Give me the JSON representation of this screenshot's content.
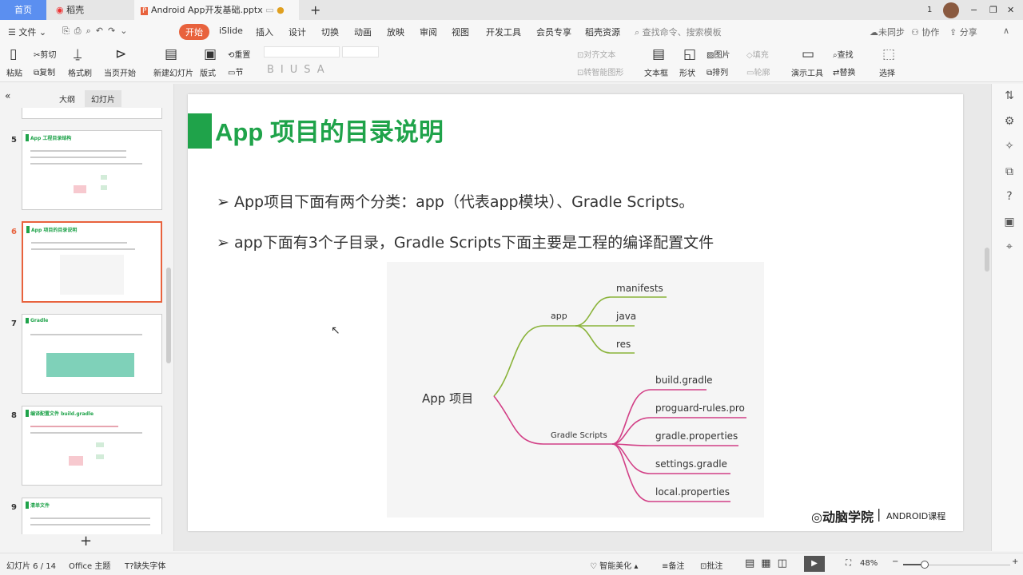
{
  "tabs": {
    "home": "首页",
    "daoke": "稻壳",
    "doc": "Android  App开发基础.pptx",
    "new": "+"
  },
  "window": {
    "count": "1",
    "min": "−",
    "restore": "❐",
    "close": "✕"
  },
  "menu": {
    "file": "文件",
    "items": [
      "开始",
      "iSlide",
      "插入",
      "设计",
      "切换",
      "动画",
      "放映",
      "审阅",
      "视图",
      "开发工具",
      "会员专享",
      "稻壳资源"
    ],
    "search": "查找命令、搜索模板",
    "sync": "未同步",
    "collab": "协作",
    "share": "分享"
  },
  "ribbon": {
    "paste": "粘贴",
    "cut": "剪切",
    "copy": "复制",
    "format_painter": "格式刷",
    "play_current": "当页开始",
    "new_slide": "新建幻灯片",
    "layout": "版式",
    "reset": "重置",
    "section": "节",
    "align_text": "对齐文本",
    "smart_art": "转智能图形",
    "textbox": "文本框",
    "shape": "形状",
    "picture": "图片",
    "fill": "填充",
    "arrange": "排列",
    "outline": "轮廓",
    "present_tools": "演示工具",
    "find": "查找",
    "replace": "替换",
    "select": "选择"
  },
  "panel": {
    "outline_tab": "大纲",
    "slides_tab": "幻灯片",
    "add": "+",
    "slides": [
      {
        "num": "5",
        "title": "App 工程目录结构"
      },
      {
        "num": "6",
        "title": "App 项目的目录说明"
      },
      {
        "num": "7",
        "title": "Gradle"
      },
      {
        "num": "8",
        "title": "编译配置文件 build.gradle"
      },
      {
        "num": "9",
        "title": "清单文件"
      }
    ]
  },
  "slide": {
    "title": "App 项目的目录说明",
    "bullets": [
      "App项目下面有两个分类：app（代表app模块）、Gradle Scripts。",
      "app下面有3个子目录，Gradle Scripts下面主要是工程的编译配置文件"
    ],
    "mindmap": {
      "root": "App 项目",
      "app": "app",
      "app_children": [
        "manifests",
        "java",
        "res"
      ],
      "gradle": "Gradle Scripts",
      "gradle_children": [
        "build.gradle",
        "proguard-rules.pro",
        "gradle.properties",
        "settings.gradle",
        "local.properties"
      ]
    },
    "logo": "动脑学院",
    "course": "ANDROID课程",
    "colors": {
      "green": "#1fa34a",
      "app_branch": "#8ab33a",
      "gradle_branch": "#d23f86"
    }
  },
  "status": {
    "slide_count": "幻灯片 6 / 14",
    "theme": "Office 主题",
    "missing_font": "缺失字体",
    "beautify": "智能美化",
    "notes": "备注",
    "comment": "批注",
    "zoom": "48%"
  }
}
